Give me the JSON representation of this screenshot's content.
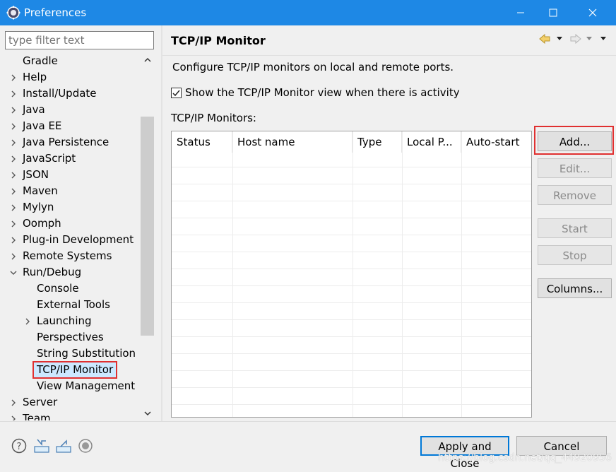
{
  "window": {
    "title": "Preferences"
  },
  "filter": {
    "placeholder": "type filter text"
  },
  "tree": {
    "items": [
      {
        "label": "Gradle",
        "expandable": false,
        "level": 0
      },
      {
        "label": "Help",
        "expandable": true,
        "level": 0
      },
      {
        "label": "Install/Update",
        "expandable": true,
        "level": 0
      },
      {
        "label": "Java",
        "expandable": true,
        "level": 0
      },
      {
        "label": "Java EE",
        "expandable": true,
        "level": 0
      },
      {
        "label": "Java Persistence",
        "expandable": true,
        "level": 0
      },
      {
        "label": "JavaScript",
        "expandable": true,
        "level": 0
      },
      {
        "label": "JSON",
        "expandable": true,
        "level": 0
      },
      {
        "label": "Maven",
        "expandable": true,
        "level": 0
      },
      {
        "label": "Mylyn",
        "expandable": true,
        "level": 0
      },
      {
        "label": "Oomph",
        "expandable": true,
        "level": 0
      },
      {
        "label": "Plug-in Development",
        "expandable": true,
        "level": 0
      },
      {
        "label": "Remote Systems",
        "expandable": true,
        "level": 0
      },
      {
        "label": "Run/Debug",
        "expandable": true,
        "expanded": true,
        "level": 0
      },
      {
        "label": "Console",
        "expandable": false,
        "level": 1
      },
      {
        "label": "External Tools",
        "expandable": false,
        "level": 1
      },
      {
        "label": "Launching",
        "expandable": true,
        "level": 1
      },
      {
        "label": "Perspectives",
        "expandable": false,
        "level": 1
      },
      {
        "label": "String Substitution",
        "expandable": false,
        "level": 1
      },
      {
        "label": "TCP/IP Monitor",
        "expandable": false,
        "level": 1,
        "selected": true
      },
      {
        "label": "View Management",
        "expandable": false,
        "level": 1
      },
      {
        "label": "Server",
        "expandable": true,
        "level": 0
      },
      {
        "label": "Team",
        "expandable": true,
        "level": 0
      }
    ]
  },
  "page": {
    "title": "TCP/IP Monitor",
    "description": "Configure TCP/IP monitors on local and remote ports.",
    "show_view_checkbox": {
      "label": "Show the TCP/IP Monitor view when there is activity",
      "checked": true
    },
    "monitors_label": "TCP/IP Monitors:"
  },
  "table": {
    "columns": [
      "Status",
      "Host name",
      "Type",
      "Local P...",
      "Auto-start"
    ],
    "rows": []
  },
  "buttons": {
    "add": "Add...",
    "edit": "Edit...",
    "remove": "Remove",
    "start": "Start",
    "stop": "Stop",
    "columns": "Columns..."
  },
  "footer": {
    "apply_close": "Apply and Close",
    "cancel": "Cancel"
  },
  "watermark": "https://blog.csdn.net/qq_44920956",
  "colors": {
    "titlebar": "#1e88e5",
    "highlight_red": "#e03030",
    "selection": "#cce8ff",
    "default_button_border": "#0078d7"
  }
}
